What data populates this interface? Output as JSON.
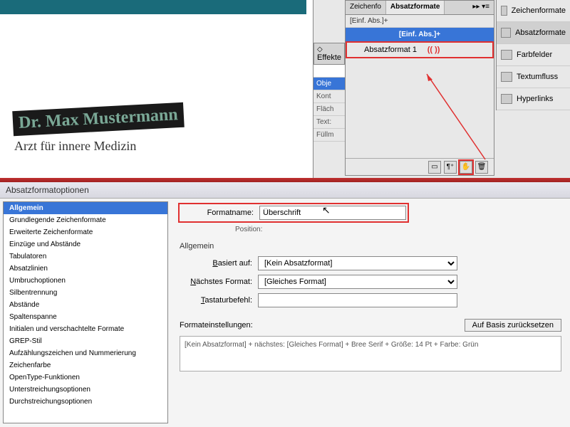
{
  "document": {
    "heading": "Dr. Max Mustermann",
    "subheading": "Arzt für innere Medizin"
  },
  "panels": {
    "tabs": {
      "zeichen": "Zeichenfo",
      "absatz": "Absatzformate"
    },
    "effects_tab": "Effekte",
    "effects_items": [
      "Obje",
      "Kont",
      "Fläch",
      "Text:",
      "Füllm"
    ],
    "absatz_sub": "[Einf. Abs.]+",
    "absatz_selected": "[Einf. Abs.]+",
    "absatz_item1": "Absatzformat 1",
    "paren": "((   ))"
  },
  "right_sidebar": {
    "items": [
      "Zeichenformate",
      "Absatzformate",
      "Farbfelder",
      "Textumfluss",
      "Hyperlinks"
    ]
  },
  "dialog": {
    "title": "Absatzformatoptionen",
    "sidebar": [
      "Allgemein",
      "Grundlegende Zeichenformate",
      "Erweiterte Zeichenformate",
      "Einzüge und Abstände",
      "Tabulatoren",
      "Absatzlinien",
      "Umbruchoptionen",
      "Silbentrennung",
      "Abstände",
      "Spaltenspanne",
      "Initialen und verschachtelte Formate",
      "GREP-Stil",
      "Aufzählungszeichen und Nummerierung",
      "Zeichenfarbe",
      "OpenType-Funktionen",
      "Unterstreichungsoptionen",
      "Durchstreichungsoptionen"
    ],
    "formatname_label": "Formatname:",
    "formatname_value": "Überschrift",
    "position_label": "Position:",
    "section": "Allgemein",
    "basiert_label": "Basiert auf:",
    "basiert_value": "[Kein Absatzformat]",
    "naechstes_label": "Nächstes Format:",
    "naechstes_value": "[Gleiches Format]",
    "tastatur_label": "Tastaturbefehl:",
    "tastatur_value": "",
    "settings_label": "Formateinstellungen:",
    "reset_button": "Auf Basis zurücksetzen",
    "settings_text": "[Kein Absatzformat] + nächstes: [Gleiches Format] + Bree Serif + Größe: 14 Pt + Farbe: Grün"
  }
}
